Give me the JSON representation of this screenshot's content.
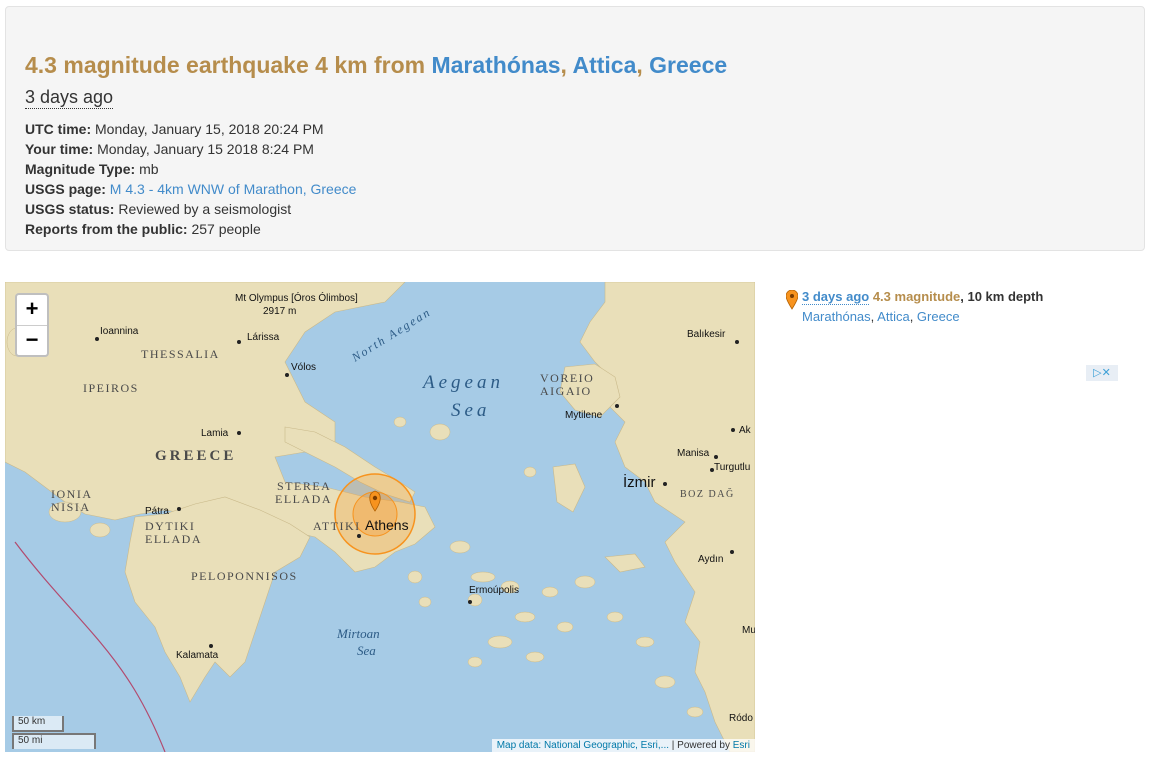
{
  "header": {
    "title_prefix": "4.3 magnitude earthquake 4 km from ",
    "place": "Marathónas",
    "sep1": ", ",
    "region": "Attica",
    "sep2": ", ",
    "country": "Greece",
    "time_ago": "3 days ago"
  },
  "info": [
    {
      "label": "UTC time:",
      "value": "Monday, January 15, 2018 20:24 PM"
    },
    {
      "label": "Your time:",
      "value": "Monday, January 15 2018 8:24 PM"
    },
    {
      "label": "Magnitude Type:",
      "value": "mb"
    },
    {
      "label": "USGS page:",
      "value": "M 4.3 - 4km WNW of Marathon, Greece"
    },
    {
      "label": "USGS status:",
      "value": "Reviewed by a seismologist"
    },
    {
      "label": "Reports from the public:",
      "value": "257 people"
    }
  ],
  "map": {
    "zoom_in": "+",
    "zoom_out": "−",
    "scale_km": "50 km",
    "scale_mi": "50 mi",
    "attribution_prefix": "Map data: ",
    "attribution_link": "National Geographic, Esri,...",
    "attribution_sep": " | Powered by ",
    "attribution_esri": "Esri",
    "labels": {
      "olympus": "Mt Olympus [Óros Ólimbos]",
      "olympus_elev": "2917 m",
      "ioannina": "Ioannina",
      "larissa": "Lárissa",
      "volos": "Vólos",
      "thessalia": "THESSALIA",
      "ipeiros": "IPEIROS",
      "lamia": "Lamia",
      "greece": "GREECE",
      "ionia1": "IONIA",
      "ionia2": "NISIA",
      "sterea1": "STEREA",
      "sterea2": "ELLADA",
      "patra": "Pátra",
      "dytiki1": "DYTIKI",
      "dytiki2": "ELLADA",
      "attiki": "ATTIKI",
      "athens": "Athens",
      "peloponnisos": "PELOPONNISOS",
      "kalamata": "Kalamata",
      "mirtoan1": "Mirtoan",
      "mirtoan2": "Sea",
      "ermoupolis": "Ermoúpolis",
      "aegean1": "Aegean",
      "aegean2": "Sea",
      "north_aegean": "North Aegean",
      "voreio1": "VOREIO",
      "voreio2": "AIGAIO",
      "mytilene": "Mytilene",
      "balikesir": "Balıkesir",
      "izmir": "İzmir",
      "manisa": "Manisa",
      "turgutlu": "Turgutlu",
      "aydin": "Aydın",
      "ak": "Ak",
      "bozdag": "BOZ DAĞ",
      "rodo": "Ródo",
      "mu": "Mu"
    }
  },
  "side": {
    "time_ago": "3 days ago",
    "magnitude": "4.3 magnitude",
    "depth": ", 10 km depth",
    "place": "Marathónas",
    "sep1": ", ",
    "region": "Attica",
    "sep2": ", ",
    "country": "Greece",
    "ad_label": "▷✕"
  },
  "colors": {
    "accent_mag": "#b68d4c",
    "link": "#428bca",
    "marker": "#f7931e"
  }
}
